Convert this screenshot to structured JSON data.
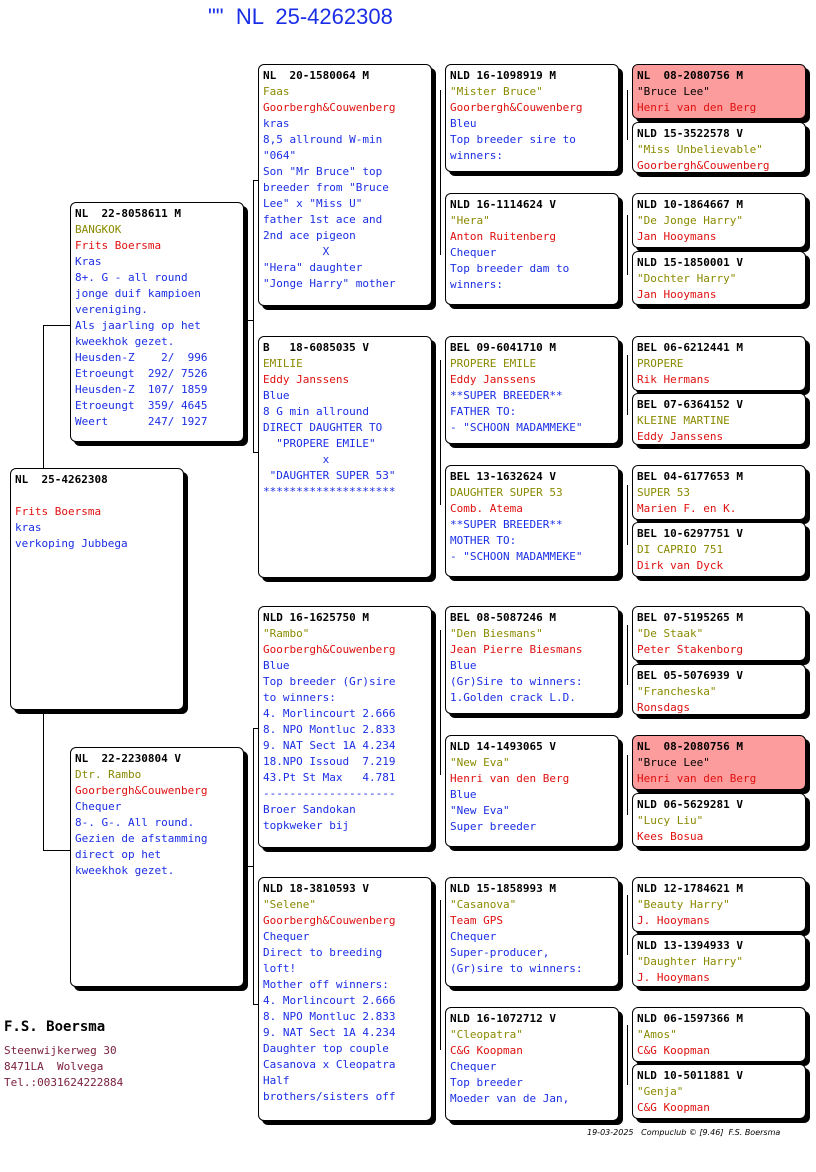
{
  "title": "\"\"  NL  25-4262308",
  "breeder": {
    "name": "F.S. Boersma",
    "street": "Steenwijkerweg 30",
    "city": "8471LA  Wolvega",
    "phone": "Tel.:0031624222884"
  },
  "footer": "19-03-2025   Compuclub © [9.46]  F.S. Boersma",
  "subject": {
    "ring": "NL  25-4262308",
    "lines": [
      "",
      {
        "t": "Frits Boersma",
        "c": "owner"
      },
      {
        "t": "kras",
        "c": "txt"
      },
      {
        "t": "verkoping Jubbega",
        "c": "txt"
      }
    ]
  },
  "sire": {
    "ring": "NL  22-8058611 M",
    "lines": [
      {
        "t": "BANGKOK",
        "c": "name"
      },
      {
        "t": "Frits Boersma",
        "c": "owner"
      },
      {
        "t": "Kras",
        "c": "txt"
      },
      {
        "t": "8+. G - all round",
        "c": "txt"
      },
      {
        "t": "jonge duif kampioen",
        "c": "txt"
      },
      {
        "t": "vereniging.",
        "c": "txt"
      },
      {
        "t": "Als jaarling op het",
        "c": "txt"
      },
      {
        "t": "kweekhok gezet.",
        "c": "txt"
      },
      {
        "t": "Heusden-Z    2/  996",
        "c": "txt"
      },
      {
        "t": "Etroeungt  292/ 7526",
        "c": "txt"
      },
      {
        "t": "Heusden-Z  107/ 1859",
        "c": "txt"
      },
      {
        "t": "Etroeungt  359/ 4645",
        "c": "txt"
      },
      {
        "t": "Weert      247/ 1927",
        "c": "txt"
      }
    ]
  },
  "dam": {
    "ring": "NL  22-2230804 V",
    "lines": [
      {
        "t": "Dtr. Rambo",
        "c": "name"
      },
      {
        "t": "Goorbergh&Couwenberg",
        "c": "owner"
      },
      {
        "t": "Chequer",
        "c": "txt"
      },
      {
        "t": "8-. G-. All round.",
        "c": "txt"
      },
      {
        "t": "Gezien de afstamming",
        "c": "txt"
      },
      {
        "t": "direct op het",
        "c": "txt"
      },
      {
        "t": "kweekhok gezet.",
        "c": "txt"
      }
    ]
  },
  "ss": {
    "ring": "NL  20-1580064 M",
    "lines": [
      {
        "t": "Faas",
        "c": "name"
      },
      {
        "t": "Goorbergh&Couwenberg",
        "c": "owner"
      },
      {
        "t": "kras",
        "c": "txt"
      },
      {
        "t": "8,5 allround W-min",
        "c": "txt"
      },
      {
        "t": "\"064\"",
        "c": "txt"
      },
      {
        "t": "Son \"Mr Bruce\" top",
        "c": "txt"
      },
      {
        "t": "breeder from \"Bruce",
        "c": "txt"
      },
      {
        "t": "Lee\" x \"Miss U\"",
        "c": "txt"
      },
      {
        "t": "father 1st ace and",
        "c": "txt"
      },
      {
        "t": "2nd ace pigeon",
        "c": "txt"
      },
      {
        "t": "         X",
        "c": "txt"
      },
      {
        "t": "\"Hera\" daughter",
        "c": "txt"
      },
      {
        "t": "\"Jonge Harry\" mother",
        "c": "txt"
      }
    ]
  },
  "sd": {
    "ring": "B   18-6085035 V",
    "lines": [
      {
        "t": "EMILIE",
        "c": "name"
      },
      {
        "t": "Eddy Janssens",
        "c": "owner"
      },
      {
        "t": "Blue",
        "c": "txt"
      },
      {
        "t": "8 G min allround",
        "c": "txt"
      },
      {
        "t": "DIRECT DAUGHTER TO",
        "c": "txt"
      },
      {
        "t": "  \"PROPERE EMILE\"",
        "c": "txt"
      },
      {
        "t": "         x",
        "c": "txt"
      },
      {
        "t": " \"DAUGHTER SUPER 53\"",
        "c": "txt"
      },
      {
        "t": "********************",
        "c": "txt"
      }
    ]
  },
  "ds": {
    "ring": "NLD 16-1625750 M",
    "lines": [
      {
        "t": "\"Rambo\"",
        "c": "name"
      },
      {
        "t": "Goorbergh&Couwenberg",
        "c": "owner"
      },
      {
        "t": "Blue",
        "c": "txt"
      },
      {
        "t": "Top breeder (Gr)sire",
        "c": "txt"
      },
      {
        "t": "to winners:",
        "c": "txt"
      },
      {
        "t": "4. Morlincourt 2.666",
        "c": "txt"
      },
      {
        "t": "8. NPO Montluc 2.833",
        "c": "txt"
      },
      {
        "t": "9. NAT Sect 1A 4.234",
        "c": "txt"
      },
      {
        "t": "18.NPO Issoud  7.219",
        "c": "txt"
      },
      {
        "t": "43.Pt St Max   4.781",
        "c": "txt"
      },
      {
        "t": "--------------------",
        "c": "txt"
      },
      {
        "t": "Broer Sandokan",
        "c": "txt"
      },
      {
        "t": "topkweker bij",
        "c": "txt"
      }
    ]
  },
  "dd": {
    "ring": "NLD 18-3810593 V",
    "lines": [
      {
        "t": "\"Selene\"",
        "c": "name"
      },
      {
        "t": "Goorbergh&Couwenberg",
        "c": "owner"
      },
      {
        "t": "Chequer",
        "c": "txt"
      },
      {
        "t": "Direct to breeding",
        "c": "txt"
      },
      {
        "t": "loft!",
        "c": "txt"
      },
      {
        "t": "Mother off winners:",
        "c": "txt"
      },
      {
        "t": "4. Morlincourt 2.666",
        "c": "txt"
      },
      {
        "t": "8. NPO Montluc 2.833",
        "c": "txt"
      },
      {
        "t": "9. NAT Sect 1A 4.234",
        "c": "txt"
      },
      {
        "t": "Daughter top couple",
        "c": "txt"
      },
      {
        "t": "Casanova x Cleopatra",
        "c": "txt"
      },
      {
        "t": "Half",
        "c": "txt"
      },
      {
        "t": "brothers/sisters off",
        "c": "txt"
      }
    ]
  },
  "sss": {
    "ring": "NLD 16-1098919 M",
    "lines": [
      {
        "t": "\"Mister Bruce\"",
        "c": "name"
      },
      {
        "t": "Goorbergh&Couwenberg",
        "c": "owner"
      },
      {
        "t": "Bleu",
        "c": "txt"
      },
      {
        "t": "Top breeder sire to",
        "c": "txt"
      },
      {
        "t": "winners:",
        "c": "txt"
      }
    ]
  },
  "ssd": {
    "ring": "NLD 16-1114624 V",
    "lines": [
      {
        "t": "\"Hera\"",
        "c": "name"
      },
      {
        "t": "Anton Ruitenberg",
        "c": "owner"
      },
      {
        "t": "Chequer",
        "c": "txt"
      },
      {
        "t": "Top breeder dam to",
        "c": "txt"
      },
      {
        "t": "winners:",
        "c": "txt"
      }
    ]
  },
  "sds": {
    "ring": "BEL 09-6041710 M",
    "lines": [
      {
        "t": "PROPERE EMILE",
        "c": "name"
      },
      {
        "t": "Eddy Janssens",
        "c": "owner"
      },
      {
        "t": "**SUPER BREEDER**",
        "c": "txt"
      },
      {
        "t": "FATHER TO:",
        "c": "txt"
      },
      {
        "t": "- \"SCHOON MADAMMEKE\"",
        "c": "txt"
      }
    ]
  },
  "sdd": {
    "ring": "BEL 13-1632624 V",
    "lines": [
      {
        "t": "DAUGHTER SUPER 53",
        "c": "name"
      },
      {
        "t": "Comb. Atema",
        "c": "owner"
      },
      {
        "t": "**SUPER BREEDER**",
        "c": "txt"
      },
      {
        "t": "MOTHER TO:",
        "c": "txt"
      },
      {
        "t": "- \"SCHOON MADAMMEKE\"",
        "c": "txt"
      }
    ]
  },
  "dss": {
    "ring": "BEL 08-5087246 M",
    "lines": [
      {
        "t": "\"Den Biesmans\"",
        "c": "name"
      },
      {
        "t": "Jean Pierre Biesmans",
        "c": "owner"
      },
      {
        "t": "Blue",
        "c": "txt"
      },
      {
        "t": "(Gr)Sire to winners:",
        "c": "txt"
      },
      {
        "t": "1.Golden crack L.D.",
        "c": "txt"
      }
    ]
  },
  "dsd": {
    "ring": "NLD 14-1493065 V",
    "lines": [
      {
        "t": "\"New Eva\"",
        "c": "name"
      },
      {
        "t": "Henri van den Berg",
        "c": "owner"
      },
      {
        "t": "Blue",
        "c": "txt"
      },
      {
        "t": "\"New Eva\"",
        "c": "txt"
      },
      {
        "t": "Super breeder",
        "c": "txt"
      }
    ]
  },
  "dds": {
    "ring": "NLD 15-1858993 M",
    "lines": [
      {
        "t": "\"Casanova\"",
        "c": "name"
      },
      {
        "t": "Team GPS",
        "c": "owner"
      },
      {
        "t": "Chequer",
        "c": "txt"
      },
      {
        "t": "Super-producer,",
        "c": "txt"
      },
      {
        "t": "(Gr)sire to winners:",
        "c": "txt"
      }
    ]
  },
  "ddd": {
    "ring": "NLD 16-1072712 V",
    "lines": [
      {
        "t": "\"Cleopatra\"",
        "c": "name"
      },
      {
        "t": "C&G Koopman",
        "c": "owner"
      },
      {
        "t": "Chequer",
        "c": "txt"
      },
      {
        "t": "Top breeder",
        "c": "txt"
      },
      {
        "t": "Moeder van de Jan,",
        "c": "txt"
      }
    ]
  },
  "g1": {
    "ring": "NL  08-2080756 M",
    "lines": [
      {
        "t": "\"Bruce Lee\"",
        "c": "ring-plain"
      },
      {
        "t": "Henri van den Berg",
        "c": "owner"
      }
    ]
  },
  "g2": {
    "ring": "NLD 15-3522578 V",
    "lines": [
      {
        "t": "\"Miss Unbelievable\"",
        "c": "name"
      },
      {
        "t": "Goorbergh&Couwenberg",
        "c": "owner"
      }
    ]
  },
  "g3": {
    "ring": "NLD 10-1864667 M",
    "lines": [
      {
        "t": "\"De Jonge Harry\"",
        "c": "name"
      },
      {
        "t": "Jan Hooymans",
        "c": "owner"
      }
    ]
  },
  "g4": {
    "ring": "NLD 15-1850001 V",
    "lines": [
      {
        "t": "\"Dochter Harry\"",
        "c": "name"
      },
      {
        "t": "Jan Hooymans",
        "c": "owner"
      }
    ]
  },
  "g5": {
    "ring": "BEL 06-6212441 M",
    "lines": [
      {
        "t": "PROPERE",
        "c": "name"
      },
      {
        "t": "Rik Hermans",
        "c": "owner"
      }
    ]
  },
  "g6": {
    "ring": "BEL 07-6364152 V",
    "lines": [
      {
        "t": "KLEINE MARTINE",
        "c": "name"
      },
      {
        "t": "Eddy Janssens",
        "c": "owner"
      }
    ]
  },
  "g7": {
    "ring": "BEL 04-6177653 M",
    "lines": [
      {
        "t": "SUPER 53",
        "c": "name"
      },
      {
        "t": "Marien F. en K.",
        "c": "owner"
      }
    ]
  },
  "g8": {
    "ring": "BEL 10-6297751 V",
    "lines": [
      {
        "t": "DI CAPRIO 751",
        "c": "name"
      },
      {
        "t": "Dirk van Dyck",
        "c": "owner"
      }
    ]
  },
  "g9": {
    "ring": "BEL 07-5195265 M",
    "lines": [
      {
        "t": "\"De Staak\"",
        "c": "name"
      },
      {
        "t": "Peter Stakenborg",
        "c": "owner"
      }
    ]
  },
  "g10": {
    "ring": "BEL 05-5076939 V",
    "lines": [
      {
        "t": "\"Francheska\"",
        "c": "name"
      },
      {
        "t": "Ronsdags",
        "c": "owner"
      }
    ]
  },
  "g11": {
    "ring": "NL  08-2080756 M",
    "lines": [
      {
        "t": "\"Bruce Lee\"",
        "c": "ring-plain"
      },
      {
        "t": "Henri van den Berg",
        "c": "owner"
      }
    ]
  },
  "g12": {
    "ring": "NLD 06-5629281 V",
    "lines": [
      {
        "t": "\"Lucy Liu\"",
        "c": "name"
      },
      {
        "t": "Kees Bosua",
        "c": "owner"
      }
    ]
  },
  "g13": {
    "ring": "NLD 12-1784621 M",
    "lines": [
      {
        "t": "\"Beauty Harry\"",
        "c": "name"
      },
      {
        "t": "J. Hooymans",
        "c": "owner"
      }
    ]
  },
  "g14": {
    "ring": "NLD 13-1394933 V",
    "lines": [
      {
        "t": "\"Daughter Harry\"",
        "c": "name"
      },
      {
        "t": "J. Hooymans",
        "c": "owner"
      }
    ]
  },
  "g15": {
    "ring": "NLD 06-1597366 M",
    "lines": [
      {
        "t": "\"Amos\"",
        "c": "name"
      },
      {
        "t": "C&G Koopman",
        "c": "owner"
      }
    ]
  },
  "g16": {
    "ring": "NLD 10-5011881 V",
    "lines": [
      {
        "t": "\"Genja\"",
        "c": "name"
      },
      {
        "t": "C&G Koopman",
        "c": "owner"
      }
    ]
  }
}
